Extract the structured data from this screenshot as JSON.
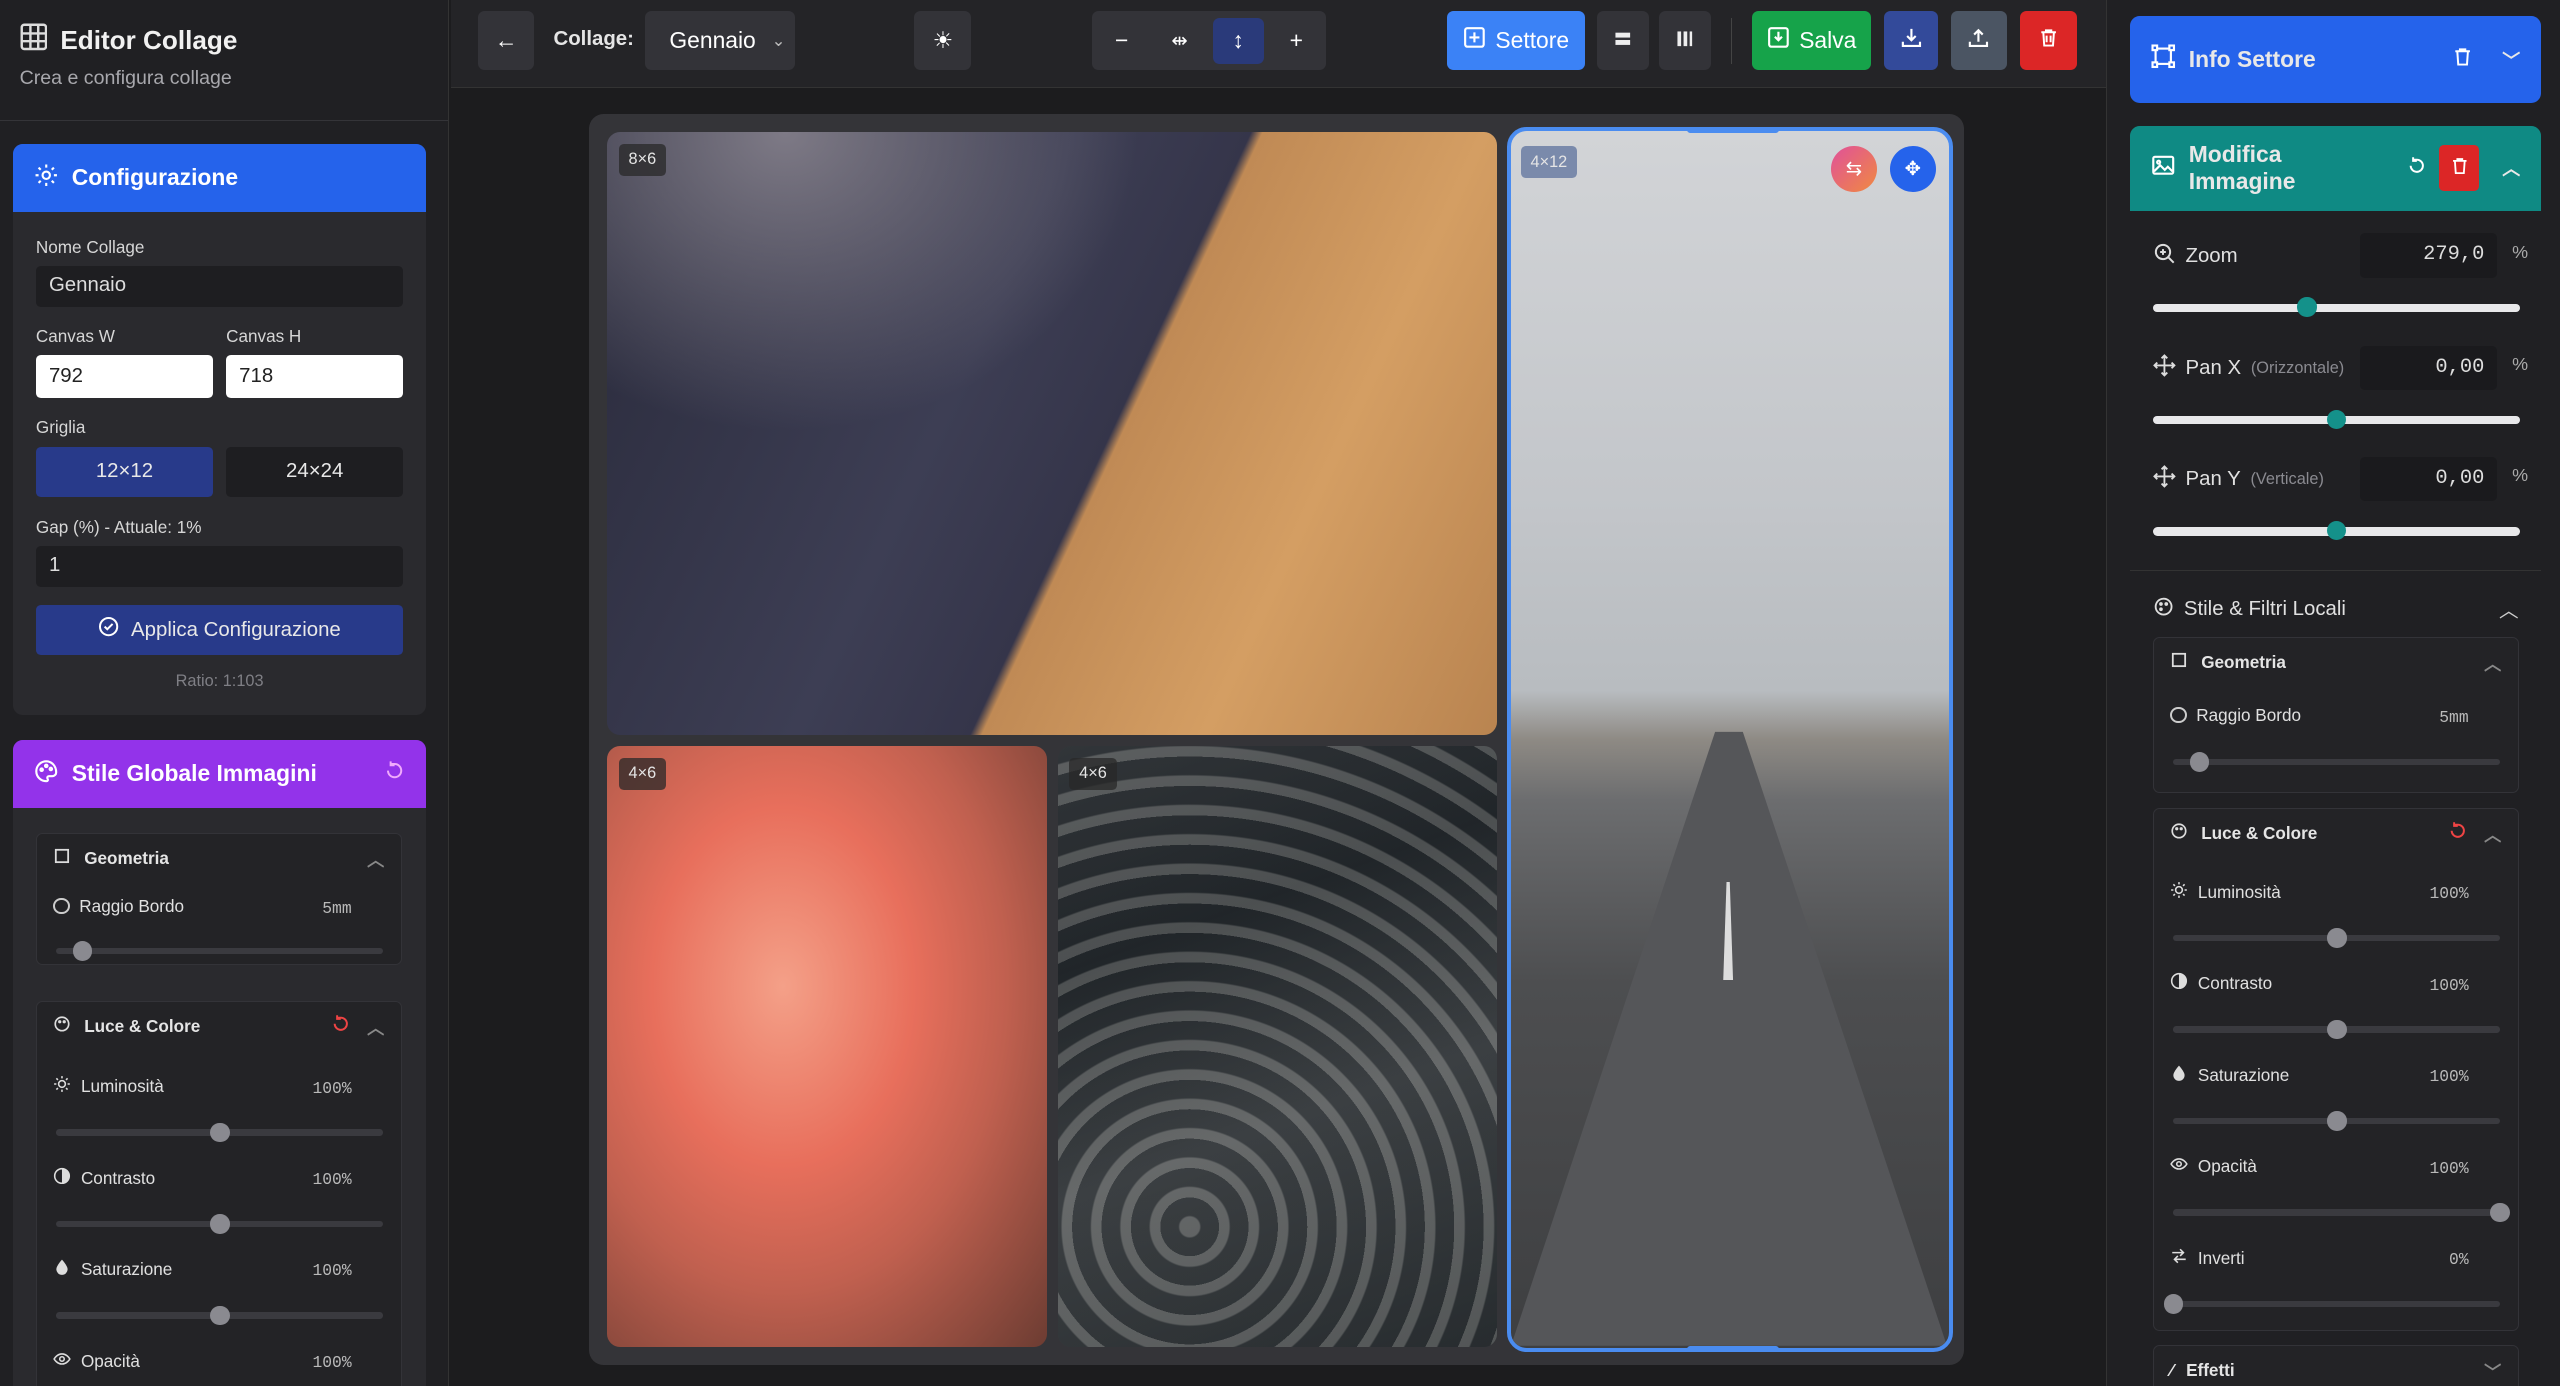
{
  "app": {
    "title": "Editor Collage",
    "subtitle": "Crea e configura collage"
  },
  "config": {
    "header": "Configurazione",
    "name_label": "Nome Collage",
    "name_value": "Gennaio",
    "canvas_w_label": "Canvas W",
    "canvas_w": "792",
    "canvas_h_label": "Canvas H",
    "canvas_h": "718",
    "grid_label": "Griglia",
    "grid_options": [
      "12×12",
      "24×24"
    ],
    "grid_selected": "12×12",
    "gap_label": "Gap (%) - Attuale: 1%",
    "gap_value": "1",
    "apply_label": "Applica Configurazione",
    "ratio": "Ratio: 1:103"
  },
  "global_style": {
    "header": "Stile Globale Immagini",
    "geometry": "Geometria",
    "radius_label": "Raggio Bordo",
    "radius_value": "5mm",
    "radius_level": 0.08,
    "light": "Luce & Colore",
    "rows": [
      {
        "label": "Luminosità",
        "value": "100%",
        "level": 0.5
      },
      {
        "label": "Contrasto",
        "value": "100%",
        "level": 0.5
      },
      {
        "label": "Saturazione",
        "value": "100%",
        "level": 0.5
      },
      {
        "label": "Opacità",
        "value": "100%",
        "level": 1
      }
    ]
  },
  "toolbar": {
    "collage_label": "Collage:",
    "collage_value": "Gennaio",
    "settore_label": "Settore",
    "salva_label": "Salva"
  },
  "tiles": [
    {
      "badge": "8×6"
    },
    {
      "badge": "4×12"
    },
    {
      "badge": "4×6"
    },
    {
      "badge": "4×6"
    }
  ],
  "info": {
    "header": "Info Settore"
  },
  "edit": {
    "header": "Modifica Immagine",
    "zoom_label": "Zoom",
    "zoom_value": "279,0",
    "zoom_level": 0.42,
    "panx_label": "Pan X",
    "panx_hint": "(Orizzontale)",
    "panx_value": "0,00",
    "panx_level": 0.5,
    "pany_label": "Pan Y",
    "pany_hint": "(Verticale)",
    "pany_value": "0,00",
    "pany_level": 0.5,
    "unit": "%"
  },
  "local": {
    "header": "Stile & Filtri Locali",
    "geometry": "Geometria",
    "radius_label": "Raggio Bordo",
    "radius_value": "5mm",
    "radius_level": 0.08,
    "light": "Luce & Colore",
    "rows": [
      {
        "label": "Luminosità",
        "value": "100%",
        "level": 0.5
      },
      {
        "label": "Contrasto",
        "value": "100%",
        "level": 0.5
      },
      {
        "label": "Saturazione",
        "value": "100%",
        "level": 0.5
      },
      {
        "label": "Opacità",
        "value": "100%",
        "level": 1
      },
      {
        "label": "Inverti",
        "value": "0%",
        "level": 0
      }
    ],
    "effects": "Effetti"
  },
  "colors": {
    "blue": "#2563eb",
    "purple": "#9333ea",
    "teal": "#0f8a84",
    "green": "#16a34a",
    "red": "#dc2626"
  }
}
